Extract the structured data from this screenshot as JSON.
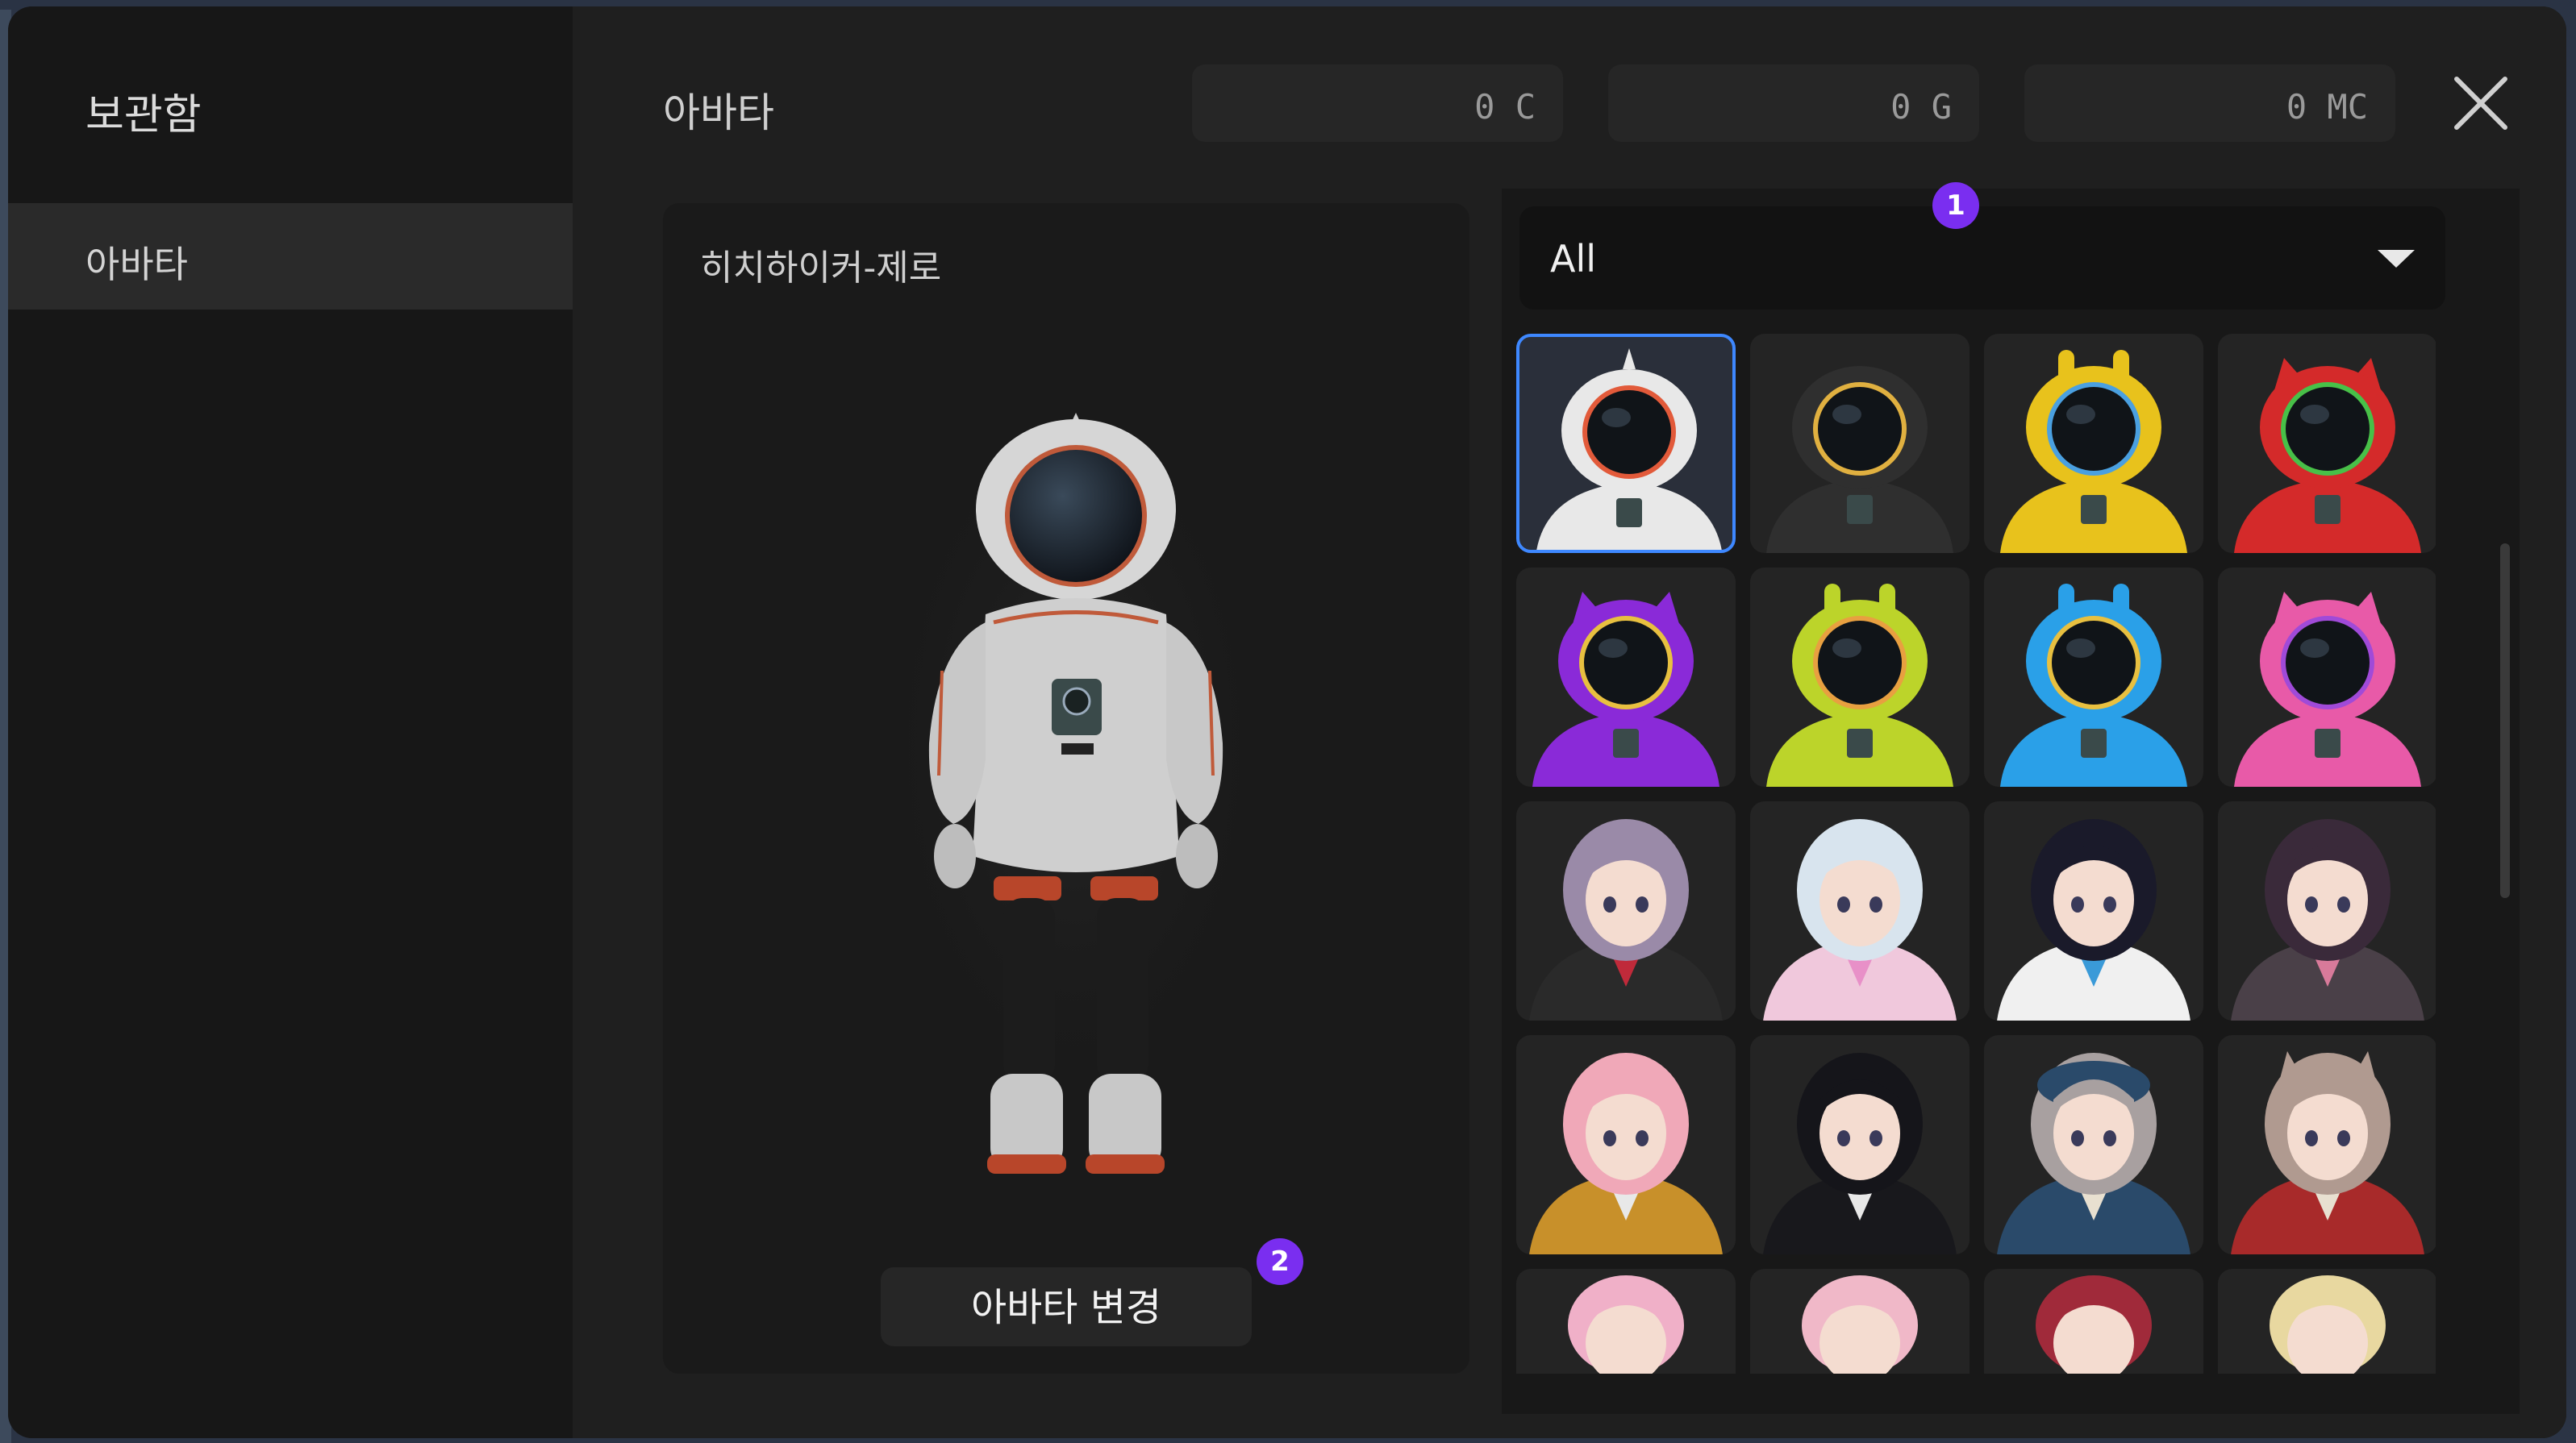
{
  "sidebar": {
    "title": "보관함",
    "items": [
      {
        "label": "아바타"
      }
    ]
  },
  "header": {
    "title": "아바타",
    "currencies": [
      {
        "value": "0 C"
      },
      {
        "value": "0 G"
      },
      {
        "value": "0 MC"
      }
    ],
    "close_icon": "close-icon"
  },
  "preview": {
    "avatar_name": "히치하이커-제로",
    "change_button_label": "아바타 변경"
  },
  "filter": {
    "selected": "All"
  },
  "badges": {
    "first": "1",
    "second": "2"
  },
  "grid": {
    "tiles": [
      {
        "kind": "astronaut",
        "color": "#e8e8e8",
        "ears": "spike",
        "ring": "#e25a3a",
        "selected": true
      },
      {
        "kind": "astronaut",
        "color": "#2f2f2f",
        "ears": "none",
        "ring": "#e0b040"
      },
      {
        "kind": "astronaut",
        "color": "#e8c21c",
        "ears": "bunny",
        "ring": "#4aa0e0"
      },
      {
        "kind": "astronaut",
        "color": "#d42a2a",
        "ears": "cat",
        "ring": "#48c048"
      },
      {
        "kind": "astronaut",
        "color": "#8a2ad8",
        "ears": "cat",
        "ring": "#e8c040"
      },
      {
        "kind": "astronaut",
        "color": "#bcd42a",
        "ears": "bunny",
        "ring": "#e8a040"
      },
      {
        "kind": "astronaut",
        "color": "#2aa0e8",
        "ears": "bunny",
        "ring": "#e8c040"
      },
      {
        "kind": "astronaut",
        "color": "#e85aa8",
        "ears": "cat",
        "ring": "#a04ad8"
      },
      {
        "kind": "character",
        "hair": "#9a8aa8",
        "outfit": "#2a2a2a",
        "accent": "#c02a3a"
      },
      {
        "kind": "character",
        "hair": "#d8e4ee",
        "outfit": "#f0c8dc",
        "accent": "#e890c8"
      },
      {
        "kind": "character",
        "hair": "#1a1a2a",
        "outfit": "#f0f0f0",
        "accent": "#3a9ad8"
      },
      {
        "kind": "character",
        "hair": "#3a2a3a",
        "outfit": "#4a4048",
        "accent": "#d87a9a"
      },
      {
        "kind": "character",
        "hair": "#f0a8b8",
        "outfit": "#c8902a",
        "accent": "#e8e8e8"
      },
      {
        "kind": "character",
        "hair": "#15151a",
        "outfit": "#18181c",
        "accent": "#e8e8e8"
      },
      {
        "kind": "character",
        "hair": "#a8a0a0",
        "outfit": "#2a4a6a",
        "accent": "#e8e0d0",
        "hat": "#2a4a6a"
      },
      {
        "kind": "character",
        "hair": "#b09a90",
        "outfit": "#a82a2a",
        "accent": "#e8e0d0",
        "ears": true
      },
      {
        "kind": "head",
        "hair": "#f0b0c8"
      },
      {
        "kind": "head",
        "hair": "#f0b8c8"
      },
      {
        "kind": "head",
        "hair": "#a02a3a"
      },
      {
        "kind": "head",
        "hair": "#e8d8a0"
      }
    ]
  }
}
